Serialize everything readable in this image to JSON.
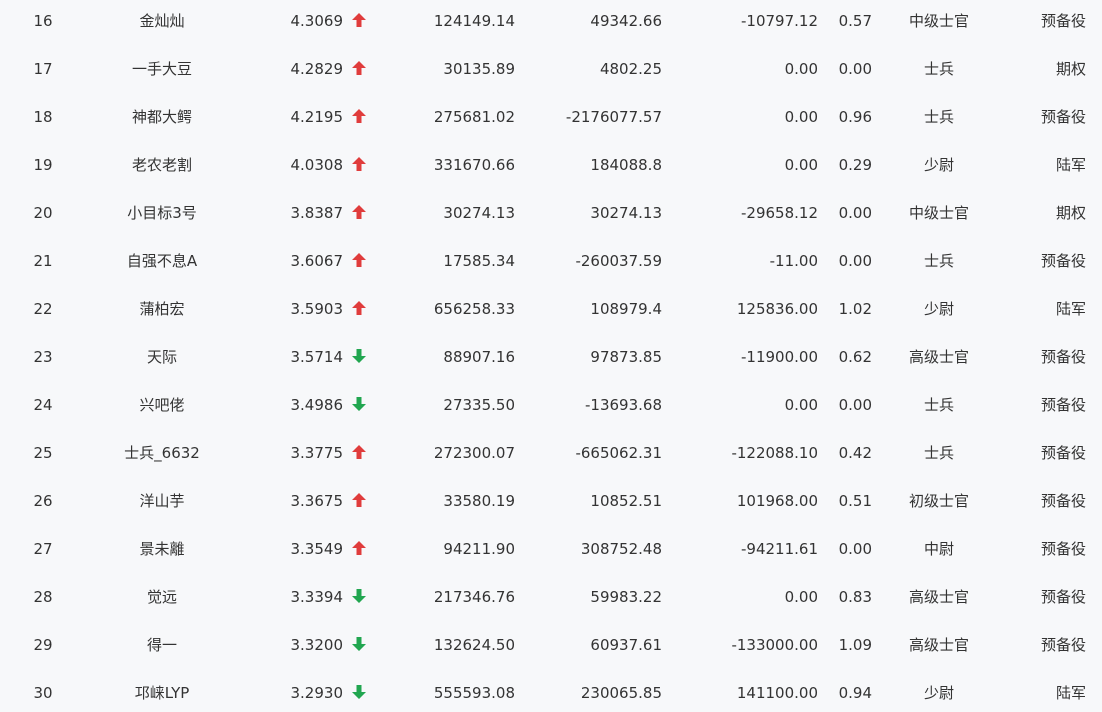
{
  "colors": {
    "up": "#e03c3c",
    "down": "#21a650",
    "text": "#333333",
    "background": "#f7f8fa"
  },
  "rows": [
    {
      "rank": "16",
      "name": "金灿灿",
      "score": "4.3069",
      "trend": "up",
      "v1": "124149.14",
      "v2": "49342.66",
      "v3": "-10797.12",
      "v4": "0.57",
      "level": "中级士官",
      "type": "预备役"
    },
    {
      "rank": "17",
      "name": "一手大豆",
      "score": "4.2829",
      "trend": "up",
      "v1": "30135.89",
      "v2": "4802.25",
      "v3": "0.00",
      "v4": "0.00",
      "level": "士兵",
      "type": "期权"
    },
    {
      "rank": "18",
      "name": "神都大鳄",
      "score": "4.2195",
      "trend": "up",
      "v1": "275681.02",
      "v2": "-2176077.57",
      "v3": "0.00",
      "v4": "0.96",
      "level": "士兵",
      "type": "预备役"
    },
    {
      "rank": "19",
      "name": "老农老割",
      "score": "4.0308",
      "trend": "up",
      "v1": "331670.66",
      "v2": "184088.8",
      "v3": "0.00",
      "v4": "0.29",
      "level": "少尉",
      "type": "陆军"
    },
    {
      "rank": "20",
      "name": "小目标3号",
      "score": "3.8387",
      "trend": "up",
      "v1": "30274.13",
      "v2": "30274.13",
      "v3": "-29658.12",
      "v4": "0.00",
      "level": "中级士官",
      "type": "期权"
    },
    {
      "rank": "21",
      "name": "自强不息A",
      "score": "3.6067",
      "trend": "up",
      "v1": "17585.34",
      "v2": "-260037.59",
      "v3": "-11.00",
      "v4": "0.00",
      "level": "士兵",
      "type": "预备役"
    },
    {
      "rank": "22",
      "name": "蒲柏宏",
      "score": "3.5903",
      "trend": "up",
      "v1": "656258.33",
      "v2": "108979.4",
      "v3": "125836.00",
      "v4": "1.02",
      "level": "少尉",
      "type": "陆军"
    },
    {
      "rank": "23",
      "name": "天际",
      "score": "3.5714",
      "trend": "down",
      "v1": "88907.16",
      "v2": "97873.85",
      "v3": "-11900.00",
      "v4": "0.62",
      "level": "高级士官",
      "type": "预备役"
    },
    {
      "rank": "24",
      "name": "兴吧佬",
      "score": "3.4986",
      "trend": "down",
      "v1": "27335.50",
      "v2": "-13693.68",
      "v3": "0.00",
      "v4": "0.00",
      "level": "士兵",
      "type": "预备役"
    },
    {
      "rank": "25",
      "name": "士兵_6632",
      "score": "3.3775",
      "trend": "up",
      "v1": "272300.07",
      "v2": "-665062.31",
      "v3": "-122088.10",
      "v4": "0.42",
      "level": "士兵",
      "type": "预备役"
    },
    {
      "rank": "26",
      "name": "洋山芋",
      "score": "3.3675",
      "trend": "up",
      "v1": "33580.19",
      "v2": "10852.51",
      "v3": "101968.00",
      "v4": "0.51",
      "level": "初级士官",
      "type": "预备役"
    },
    {
      "rank": "27",
      "name": "景未離",
      "score": "3.3549",
      "trend": "up",
      "v1": "94211.90",
      "v2": "308752.48",
      "v3": "-94211.61",
      "v4": "0.00",
      "level": "中尉",
      "type": "预备役"
    },
    {
      "rank": "28",
      "name": "觉远",
      "score": "3.3394",
      "trend": "down",
      "v1": "217346.76",
      "v2": "59983.22",
      "v3": "0.00",
      "v4": "0.83",
      "level": "高级士官",
      "type": "预备役"
    },
    {
      "rank": "29",
      "name": "得一",
      "score": "3.3200",
      "trend": "down",
      "v1": "132624.50",
      "v2": "60937.61",
      "v3": "-133000.00",
      "v4": "1.09",
      "level": "高级士官",
      "type": "预备役"
    },
    {
      "rank": "30",
      "name": "邛崃LYP",
      "score": "3.2930",
      "trend": "down",
      "v1": "555593.08",
      "v2": "230065.85",
      "v3": "141100.00",
      "v4": "0.94",
      "level": "少尉",
      "type": "陆军"
    }
  ]
}
